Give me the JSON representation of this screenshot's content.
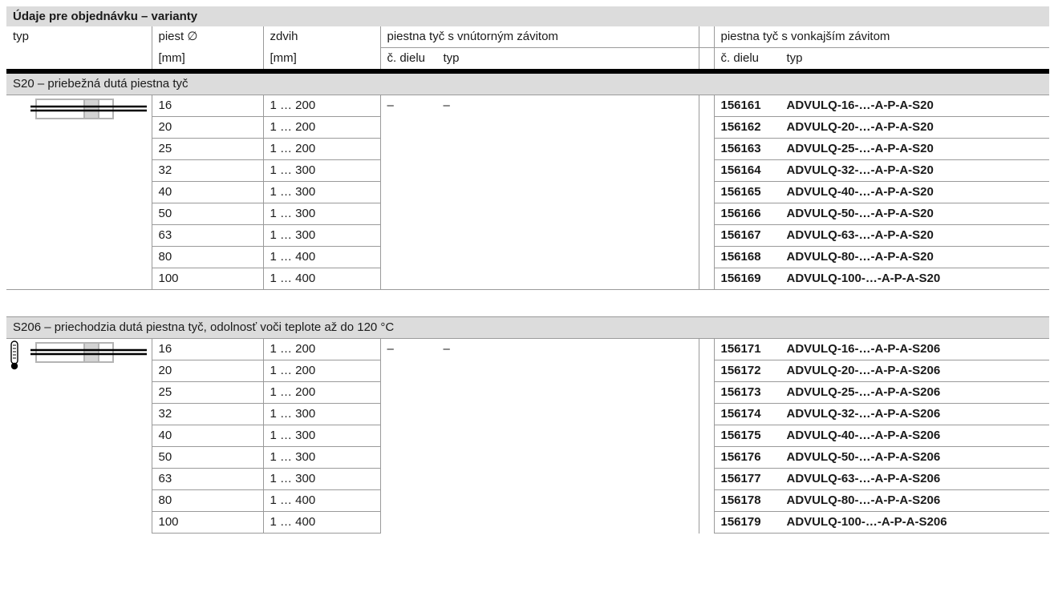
{
  "title": "Údaje pre objednávku – varianty",
  "headers": {
    "typ": "typ",
    "piest": "piest ∅",
    "zdvih": "zdvih",
    "inner_group": "piestna tyč s vnútorným závitom",
    "outer_group": "piestna tyč s vonkajším závitom",
    "mm1": "[mm]",
    "mm2": "[mm]",
    "inner_part": "č. dielu",
    "inner_type": "typ",
    "outer_part": "č. dielu",
    "outer_type": "typ"
  },
  "sections": [
    {
      "label": "S20 – priebežná dutá piestna tyč",
      "icons": [
        "cylinder-hollow-rod-icon"
      ],
      "inner_part": "–",
      "inner_type": "–",
      "rows": [
        {
          "piest": "16",
          "zdvih": "1 … 200",
          "part": "156161",
          "type": "ADVULQ-16-…-A-P-A-S20"
        },
        {
          "piest": "20",
          "zdvih": "1 … 200",
          "part": "156162",
          "type": "ADVULQ-20-…-A-P-A-S20"
        },
        {
          "piest": "25",
          "zdvih": "1 … 200",
          "part": "156163",
          "type": "ADVULQ-25-…-A-P-A-S20"
        },
        {
          "piest": "32",
          "zdvih": "1 … 300",
          "part": "156164",
          "type": "ADVULQ-32-…-A-P-A-S20"
        },
        {
          "piest": "40",
          "zdvih": "1 … 300",
          "part": "156165",
          "type": "ADVULQ-40-…-A-P-A-S20"
        },
        {
          "piest": "50",
          "zdvih": "1 … 300",
          "part": "156166",
          "type": "ADVULQ-50-…-A-P-A-S20"
        },
        {
          "piest": "63",
          "zdvih": "1 … 300",
          "part": "156167",
          "type": "ADVULQ-63-…-A-P-A-S20"
        },
        {
          "piest": "80",
          "zdvih": "1 … 400",
          "part": "156168",
          "type": "ADVULQ-80-…-A-P-A-S20"
        },
        {
          "piest": "100",
          "zdvih": "1 … 400",
          "part": "156169",
          "type": "ADVULQ-100-…-A-P-A-S20"
        }
      ]
    },
    {
      "label": "S206 – priechodzia dutá piestna tyč, odolnosť voči teplote až do 120 °C",
      "icons": [
        "thermometer-icon",
        "cylinder-hollow-rod-icon"
      ],
      "inner_part": "–",
      "inner_type": "–",
      "rows": [
        {
          "piest": "16",
          "zdvih": "1 … 200",
          "part": "156171",
          "type": "ADVULQ-16-…-A-P-A-S206"
        },
        {
          "piest": "20",
          "zdvih": "1 … 200",
          "part": "156172",
          "type": "ADVULQ-20-…-A-P-A-S206"
        },
        {
          "piest": "25",
          "zdvih": "1 … 200",
          "part": "156173",
          "type": "ADVULQ-25-…-A-P-A-S206"
        },
        {
          "piest": "32",
          "zdvih": "1 … 300",
          "part": "156174",
          "type": "ADVULQ-32-…-A-P-A-S206"
        },
        {
          "piest": "40",
          "zdvih": "1 … 300",
          "part": "156175",
          "type": "ADVULQ-40-…-A-P-A-S206"
        },
        {
          "piest": "50",
          "zdvih": "1 … 300",
          "part": "156176",
          "type": "ADVULQ-50-…-A-P-A-S206"
        },
        {
          "piest": "63",
          "zdvih": "1 … 300",
          "part": "156177",
          "type": "ADVULQ-63-…-A-P-A-S206"
        },
        {
          "piest": "80",
          "zdvih": "1 … 400",
          "part": "156178",
          "type": "ADVULQ-80-…-A-P-A-S206"
        },
        {
          "piest": "100",
          "zdvih": "1 … 400",
          "part": "156179",
          "type": "ADVULQ-100-…-A-P-A-S206"
        }
      ]
    }
  ]
}
